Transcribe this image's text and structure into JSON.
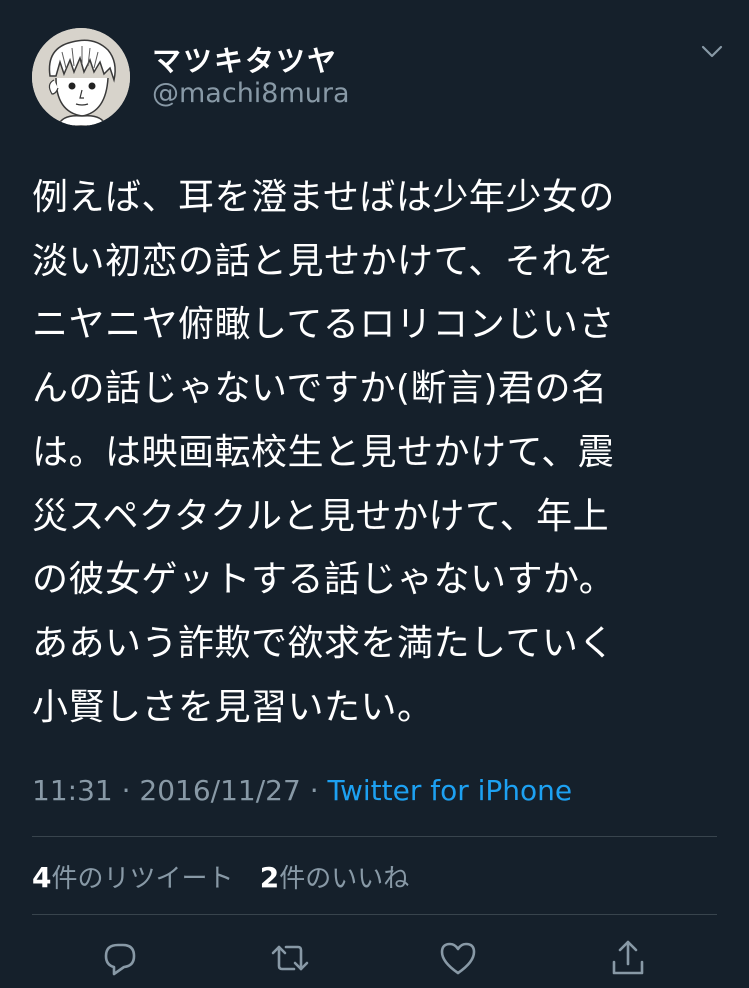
{
  "user": {
    "display_name": "マツキタツヤ",
    "handle": "@machi8mura",
    "avatar_icon": "avatar-icon"
  },
  "tweet": {
    "lines": [
      "例えば、耳を澄ませばは少年少女の",
      "淡い初恋の話と見せかけて、それを",
      "ニヤニヤ俯瞰してるロリコンじいさ",
      "んの話じゃないですか(断言)君の名",
      "は。は映画転校生と見せかけて、震",
      "災スペクタクルと見せかけて、年上",
      "の彼女ゲットする話じゃないすか。",
      "ああいう詐欺で欲求を満たしていく",
      "小賢しさを見習いたい。"
    ]
  },
  "meta": {
    "time": "11:31",
    "separator": " · ",
    "date": "2016/11/27",
    "source": "Twitter for iPhone"
  },
  "stats": {
    "retweet_count": "4",
    "retweet_label": "件のリツイート",
    "like_count": "2",
    "like_label": "件のいいね"
  },
  "actions": {
    "reply_icon": "reply-icon",
    "retweet_icon": "retweet-icon",
    "like_icon": "heart-icon",
    "share_icon": "share-icon"
  },
  "colors": {
    "background": "#15202b",
    "text": "#ffffff",
    "secondary": "#8899a6",
    "accent": "#1da1f2",
    "divider": "#38444d"
  }
}
